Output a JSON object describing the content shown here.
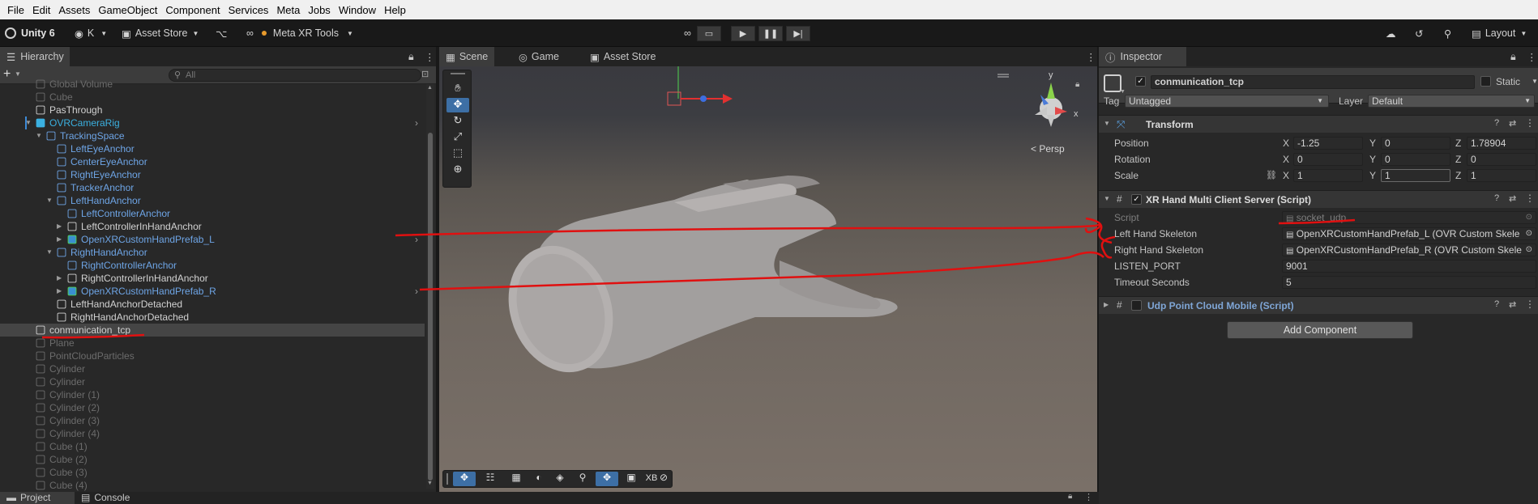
{
  "menu": [
    "File",
    "Edit",
    "Assets",
    "GameObject",
    "Component",
    "Services",
    "Meta",
    "Jobs",
    "Window",
    "Help"
  ],
  "toolbar": {
    "unity_label": "Unity 6",
    "account": "K",
    "asset_store": "Asset Store",
    "meta_tools": "Meta XR Tools",
    "layout": "Layout"
  },
  "hierarchy": {
    "tab": "Hierarchy",
    "search_placeholder": "All",
    "rows": [
      {
        "label": "Global Volume",
        "color": "grey",
        "indent": 1
      },
      {
        "label": "Cube",
        "color": "grey",
        "indent": 1
      },
      {
        "label": "PasThrough",
        "color": "white",
        "indent": 1
      },
      {
        "label": "OVRCameraRig",
        "color": "cyan",
        "indent": 1,
        "expanded": true
      },
      {
        "label": "TrackingSpace",
        "color": "blue",
        "indent": 2,
        "expanded": true
      },
      {
        "label": "LeftEyeAnchor",
        "color": "blue",
        "indent": 3
      },
      {
        "label": "CenterEyeAnchor",
        "color": "blue",
        "indent": 3
      },
      {
        "label": "RightEyeAnchor",
        "color": "blue",
        "indent": 3
      },
      {
        "label": "TrackerAnchor",
        "color": "blue",
        "indent": 3
      },
      {
        "label": "LeftHandAnchor",
        "color": "blue",
        "indent": 3,
        "expanded": true
      },
      {
        "label": "LeftControllerAnchor",
        "color": "blue",
        "indent": 4
      },
      {
        "label": "LeftControllerInHandAnchor",
        "color": "white",
        "indent": 4,
        "collapsed": true
      },
      {
        "label": "OpenXRCustomHandPrefab_L",
        "color": "blue",
        "indent": 4,
        "collapsed": true
      },
      {
        "label": "RightHandAnchor",
        "color": "blue",
        "indent": 3,
        "expanded": true
      },
      {
        "label": "RightControllerAnchor",
        "color": "blue",
        "indent": 4
      },
      {
        "label": "RightControllerInHandAnchor",
        "color": "white",
        "indent": 4,
        "collapsed": true
      },
      {
        "label": "OpenXRCustomHandPrefab_R",
        "color": "blue",
        "indent": 4,
        "collapsed": true
      },
      {
        "label": "LeftHandAnchorDetached",
        "color": "white",
        "indent": 3
      },
      {
        "label": "RightHandAnchorDetached",
        "color": "white",
        "indent": 3
      },
      {
        "label": "conmunication_tcp",
        "color": "white",
        "indent": 1,
        "selected": true
      },
      {
        "label": "Plane",
        "color": "grey",
        "indent": 1
      },
      {
        "label": "PointCloudParticles",
        "color": "grey",
        "indent": 1
      },
      {
        "label": "Cylinder",
        "color": "grey",
        "indent": 1
      },
      {
        "label": "Cylinder",
        "color": "grey",
        "indent": 1
      },
      {
        "label": "Cylinder (1)",
        "color": "grey",
        "indent": 1
      },
      {
        "label": "Cylinder (2)",
        "color": "grey",
        "indent": 1
      },
      {
        "label": "Cylinder (3)",
        "color": "grey",
        "indent": 1
      },
      {
        "label": "Cylinder (4)",
        "color": "grey",
        "indent": 1
      },
      {
        "label": "Cube (1)",
        "color": "grey",
        "indent": 1
      },
      {
        "label": "Cube (2)",
        "color": "grey",
        "indent": 1
      },
      {
        "label": "Cube (3)",
        "color": "grey",
        "indent": 1
      },
      {
        "label": "Cube (4)",
        "color": "grey",
        "indent": 1
      }
    ]
  },
  "scene": {
    "tabs": [
      "Scene",
      "Game",
      "Asset Store"
    ],
    "persp_label": "< Persp",
    "axis_y": "y",
    "axis_x": "x",
    "xb_label": "XB"
  },
  "bottom_tabs": [
    "Project",
    "Console"
  ],
  "inspector": {
    "tab": "Inspector",
    "object_name": "conmunication_tcp",
    "static_label": "Static",
    "tag_label": "Tag",
    "tag_value": "Untagged",
    "layer_label": "Layer",
    "layer_value": "Default",
    "transform": {
      "title": "Transform",
      "position_label": "Position",
      "rotation_label": "Rotation",
      "scale_label": "Scale",
      "position": {
        "x": "-1.25",
        "y": "0",
        "z": "1.78904"
      },
      "rotation": {
        "x": "0",
        "y": "0",
        "z": "0"
      },
      "scale": {
        "x": "1",
        "y": "1",
        "z": "1"
      }
    },
    "xr_server": {
      "title": "XR Hand Multi Client Server (Script)",
      "script_label": "Script",
      "script_value": "socket_udp",
      "left_label": "Left Hand Skeleton",
      "left_value": "OpenXRCustomHandPrefab_L (OVR Custom Skele",
      "right_label": "Right Hand Skeleton",
      "right_value": "OpenXRCustomHandPrefab_R (OVR Custom Skele",
      "port_label": "LISTEN_PORT",
      "port_value": "9001",
      "timeout_label": "Timeout Seconds",
      "timeout_value": "5"
    },
    "udp_cloud": {
      "title": "Udp Point Cloud Mobile (Script)"
    },
    "add_component": "Add Component"
  },
  "colors": {
    "annotation_red": "#e01010",
    "selection_blue": "#2c5d87",
    "prefab_blue": "#6ea5e6"
  }
}
